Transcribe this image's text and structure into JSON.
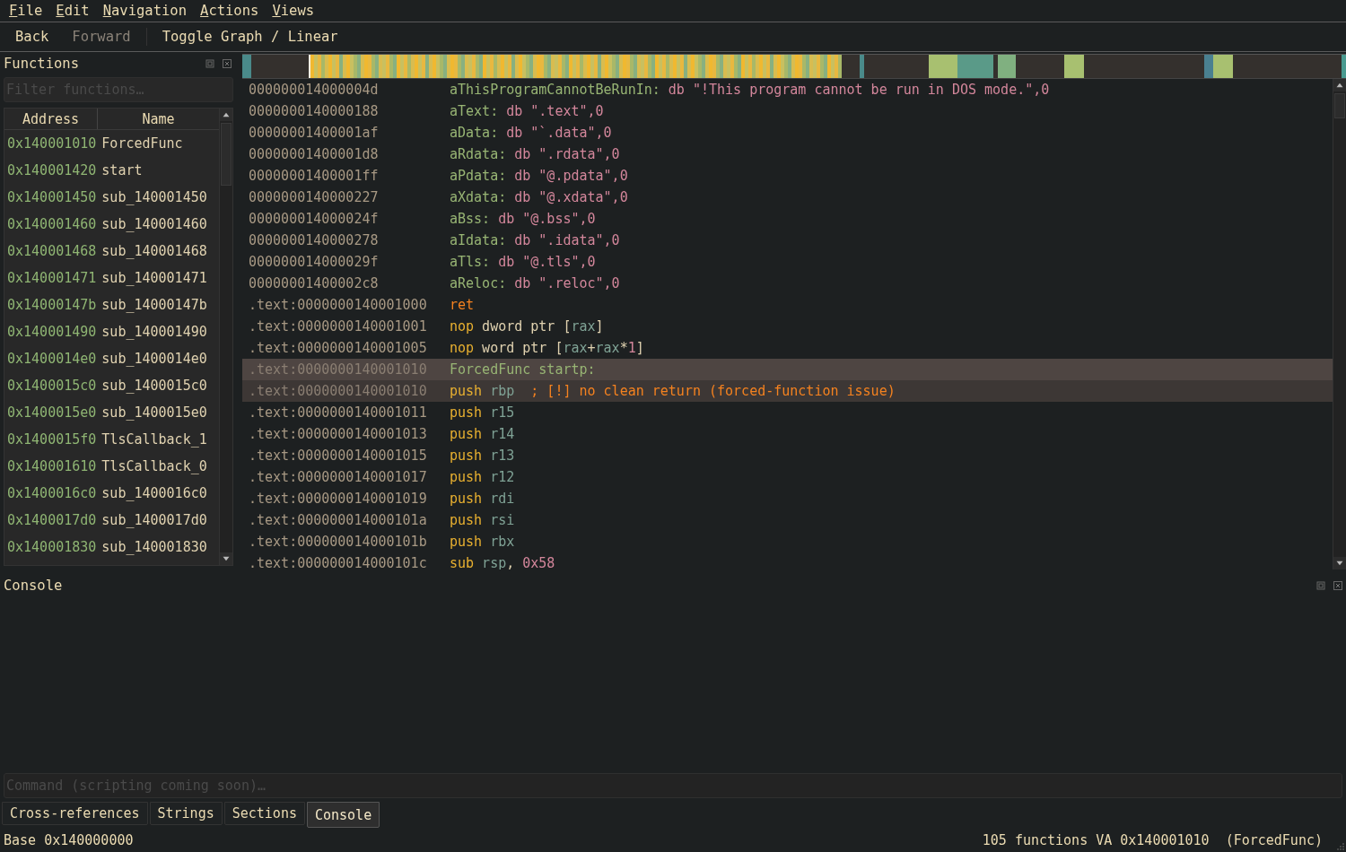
{
  "menu": [
    {
      "label": "File"
    },
    {
      "label": "Edit"
    },
    {
      "label": "Navigation"
    },
    {
      "label": "Actions"
    },
    {
      "label": "Views"
    }
  ],
  "toolbar": [
    {
      "kind": "button",
      "label": "Back",
      "disabled": false
    },
    {
      "kind": "button",
      "label": "Forward",
      "disabled": true
    },
    {
      "kind": "separator"
    },
    {
      "kind": "button",
      "label": "Toggle Graph / Linear",
      "disabled": false
    }
  ],
  "functions_panel": {
    "title": "Functions",
    "filter": {
      "placeholder": "Filter functions…"
    },
    "columns": [
      "Address",
      "Name"
    ],
    "rows": [
      {
        "address": "0x140001010",
        "name": "ForcedFunc"
      },
      {
        "address": "0x140001420",
        "name": "start"
      },
      {
        "address": "0x140001450",
        "name": "sub_140001450"
      },
      {
        "address": "0x140001460",
        "name": "sub_140001460"
      },
      {
        "address": "0x140001468",
        "name": "sub_140001468"
      },
      {
        "address": "0x140001471",
        "name": "sub_140001471"
      },
      {
        "address": "0x14000147b",
        "name": "sub_14000147b"
      },
      {
        "address": "0x140001490",
        "name": "sub_140001490"
      },
      {
        "address": "0x1400014e0",
        "name": "sub_1400014e0"
      },
      {
        "address": "0x1400015c0",
        "name": "sub_1400015c0"
      },
      {
        "address": "0x1400015e0",
        "name": "sub_1400015e0"
      },
      {
        "address": "0x1400015f0",
        "name": "TlsCallback_1"
      },
      {
        "address": "0x140001610",
        "name": "TlsCallback_0"
      },
      {
        "address": "0x1400016c0",
        "name": "sub_1400016c0"
      },
      {
        "address": "0x1400017d0",
        "name": "sub_1400017d0"
      },
      {
        "address": "0x140001830",
        "name": "sub_140001830"
      }
    ]
  },
  "disassembly": [
    {
      "address": "000000014000004d",
      "selected": false,
      "highlighted": false,
      "parts": [
        {
          "text": "aThisProgramCannotBeRunIn:",
          "kind": "label"
        },
        {
          "text": " db \"!This program cannot be run in DOS mode.\",0",
          "kind": "string"
        }
      ]
    },
    {
      "address": "0000000140000188",
      "selected": false,
      "highlighted": false,
      "parts": [
        {
          "text": "aText:",
          "kind": "label"
        },
        {
          "text": " db \".text\",0",
          "kind": "string"
        }
      ]
    },
    {
      "address": "00000001400001af",
      "selected": false,
      "highlighted": false,
      "parts": [
        {
          "text": "aData:",
          "kind": "label"
        },
        {
          "text": " db \"`.data\",0",
          "kind": "string"
        }
      ]
    },
    {
      "address": "00000001400001d8",
      "selected": false,
      "highlighted": false,
      "parts": [
        {
          "text": "aRdata:",
          "kind": "label"
        },
        {
          "text": " db \".rdata\",0",
          "kind": "string"
        }
      ]
    },
    {
      "address": "00000001400001ff",
      "selected": false,
      "highlighted": false,
      "parts": [
        {
          "text": "aPdata:",
          "kind": "label"
        },
        {
          "text": " db \"@.pdata\",0",
          "kind": "string"
        }
      ]
    },
    {
      "address": "0000000140000227",
      "selected": false,
      "highlighted": false,
      "parts": [
        {
          "text": "aXdata:",
          "kind": "label"
        },
        {
          "text": " db \"@.xdata\",0",
          "kind": "string"
        }
      ]
    },
    {
      "address": "000000014000024f",
      "selected": false,
      "highlighted": false,
      "parts": [
        {
          "text": "aBss:",
          "kind": "label"
        },
        {
          "text": " db \"@.bss\",0",
          "kind": "string"
        }
      ]
    },
    {
      "address": "0000000140000278",
      "selected": false,
      "highlighted": false,
      "parts": [
        {
          "text": "aIdata:",
          "kind": "label"
        },
        {
          "text": " db \".idata\",0",
          "kind": "string"
        }
      ]
    },
    {
      "address": "000000014000029f",
      "selected": false,
      "highlighted": false,
      "parts": [
        {
          "text": "aTls:",
          "kind": "label"
        },
        {
          "text": " db \"@.tls\",0",
          "kind": "string"
        }
      ]
    },
    {
      "address": "00000001400002c8",
      "selected": false,
      "highlighted": false,
      "parts": [
        {
          "text": "aReloc:",
          "kind": "label"
        },
        {
          "text": " db \".reloc\",0",
          "kind": "string"
        }
      ]
    },
    {
      "address": ".text:0000000140001000",
      "selected": false,
      "highlighted": false,
      "parts": [
        {
          "text": "ret",
          "kind": "flow"
        }
      ]
    },
    {
      "address": ".text:0000000140001001",
      "selected": false,
      "highlighted": false,
      "parts": [
        {
          "text": "nop",
          "kind": "mnemonic"
        },
        {
          "text": " dword ptr [",
          "kind": "plain"
        },
        {
          "text": "rax",
          "kind": "register"
        },
        {
          "text": "]",
          "kind": "plain"
        }
      ]
    },
    {
      "address": ".text:0000000140001005",
      "selected": false,
      "highlighted": false,
      "parts": [
        {
          "text": "nop",
          "kind": "mnemonic"
        },
        {
          "text": " word ptr [",
          "kind": "plain"
        },
        {
          "text": "rax",
          "kind": "register"
        },
        {
          "text": "+",
          "kind": "plain"
        },
        {
          "text": "rax",
          "kind": "register"
        },
        {
          "text": "*",
          "kind": "plain"
        },
        {
          "text": "1",
          "kind": "number"
        },
        {
          "text": "]",
          "kind": "plain"
        }
      ]
    },
    {
      "address": ".text:0000000140001010",
      "selected": true,
      "highlighted": true,
      "parts": [
        {
          "text": "ForcedFunc startp:",
          "kind": "label"
        }
      ]
    },
    {
      "address": ".text:0000000140001010",
      "selected": false,
      "highlighted": true,
      "parts": [
        {
          "text": "push",
          "kind": "mnemonic"
        },
        {
          "text": " rbp",
          "kind": "register"
        },
        {
          "text": "  ; [!] no clean return (forced-function issue)",
          "kind": "comment"
        }
      ]
    },
    {
      "address": ".text:0000000140001011",
      "selected": false,
      "highlighted": false,
      "parts": [
        {
          "text": "push",
          "kind": "mnemonic"
        },
        {
          "text": " r15",
          "kind": "register"
        }
      ]
    },
    {
      "address": ".text:0000000140001013",
      "selected": false,
      "highlighted": false,
      "parts": [
        {
          "text": "push",
          "kind": "mnemonic"
        },
        {
          "text": " r14",
          "kind": "register"
        }
      ]
    },
    {
      "address": ".text:0000000140001015",
      "selected": false,
      "highlighted": false,
      "parts": [
        {
          "text": "push",
          "kind": "mnemonic"
        },
        {
          "text": " r13",
          "kind": "register"
        }
      ]
    },
    {
      "address": ".text:0000000140001017",
      "selected": false,
      "highlighted": false,
      "parts": [
        {
          "text": "push",
          "kind": "mnemonic"
        },
        {
          "text": " r12",
          "kind": "register"
        }
      ]
    },
    {
      "address": ".text:0000000140001019",
      "selected": false,
      "highlighted": false,
      "parts": [
        {
          "text": "push",
          "kind": "mnemonic"
        },
        {
          "text": " rdi",
          "kind": "register"
        }
      ]
    },
    {
      "address": ".text:000000014000101a",
      "selected": false,
      "highlighted": false,
      "parts": [
        {
          "text": "push",
          "kind": "mnemonic"
        },
        {
          "text": " rsi",
          "kind": "register"
        }
      ]
    },
    {
      "address": ".text:000000014000101b",
      "selected": false,
      "highlighted": false,
      "parts": [
        {
          "text": "push",
          "kind": "mnemonic"
        },
        {
          "text": " rbx",
          "kind": "register"
        }
      ]
    },
    {
      "address": ".text:000000014000101c",
      "selected": false,
      "highlighted": false,
      "parts": [
        {
          "text": "sub",
          "kind": "mnemonic"
        },
        {
          "text": " rsp",
          "kind": "register"
        },
        {
          "text": ", ",
          "kind": "plain"
        },
        {
          "text": "0x58",
          "kind": "number"
        }
      ]
    }
  ],
  "console": {
    "title": "Console",
    "command": {
      "placeholder": "Command (scripting coming soon)…"
    }
  },
  "bottom_tabs": [
    {
      "label": "Cross-references",
      "selected": false
    },
    {
      "label": "Strings",
      "selected": false
    },
    {
      "label": "Sections",
      "selected": false
    },
    {
      "label": "Console",
      "selected": true
    }
  ],
  "status_bar": {
    "left": "Base 0x140000000",
    "right": [
      "105 functions",
      "VA 0x140001010",
      "(ForcedFunc)"
    ]
  }
}
